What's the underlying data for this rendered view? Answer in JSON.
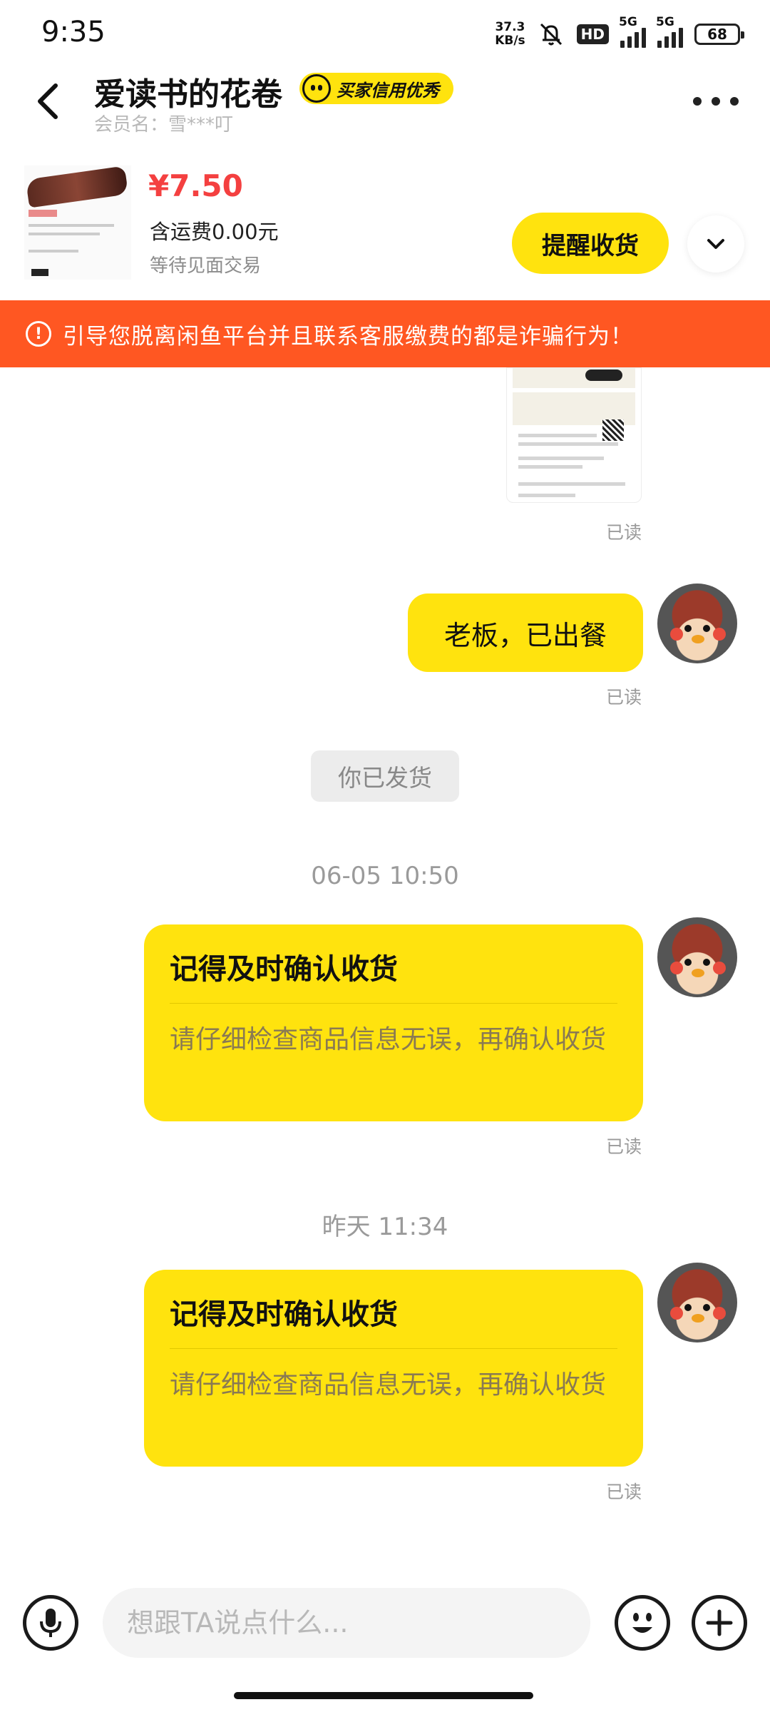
{
  "status_bar": {
    "time": "9:35",
    "net_speed_value": "37.3",
    "net_speed_unit": "KB/s",
    "hd_label": "HD",
    "sim1_label": "5G",
    "sim2_label": "5G",
    "battery": "68"
  },
  "header": {
    "title": "爱读书的花卷",
    "badge": "买家信用优秀",
    "member": "会员名：雪***叮"
  },
  "product": {
    "price": "¥7.50",
    "shipping": "含运费0.00元",
    "status": "等待见面交易",
    "remind_button": "提醒收货"
  },
  "warning": {
    "icon": "!",
    "text": "引导您脱离闲鱼平台并且联系客服缴费的都是诈骗行为！"
  },
  "messages": [
    {
      "read": "已读"
    },
    {
      "text": "老板，已出餐",
      "read": "已读"
    },
    {
      "system": "你已发货"
    },
    {
      "timestamp": "06-05 10:50",
      "card_title": "记得及时确认收货",
      "card_body": "请仔细检查商品信息无误，再确认收货",
      "read": "已读"
    },
    {
      "timestamp": "昨天 11:34",
      "card_title": "记得及时确认收货",
      "card_body": "请仔细检查商品信息无误，再确认收货",
      "read": "已读"
    }
  ],
  "input": {
    "placeholder": "想跟TA说点什么..."
  },
  "colors": {
    "accent_yellow": "#ffe30e",
    "warning_bg": "#ff5722",
    "price_red": "#f44040"
  }
}
